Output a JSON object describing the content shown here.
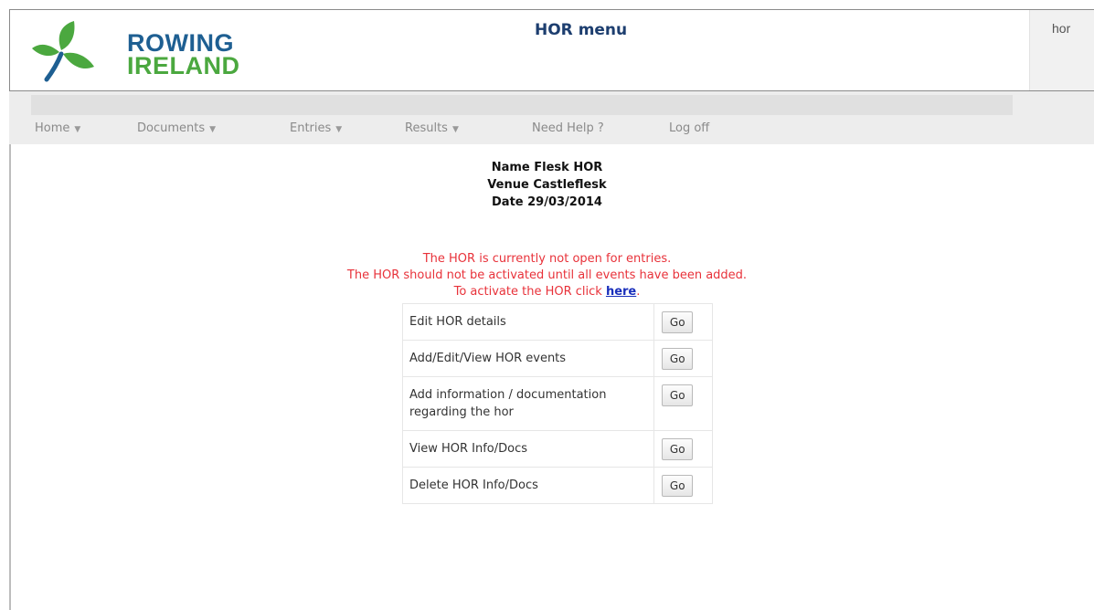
{
  "header": {
    "brand_line1": "ROWING",
    "brand_line2": "IRELAND",
    "app_title": "HOR menu",
    "username": "hor"
  },
  "nav": [
    {
      "label": "Home",
      "has_dropdown": true
    },
    {
      "label": "Documents",
      "has_dropdown": true
    },
    {
      "label": "Entries",
      "has_dropdown": true
    },
    {
      "label": "Results",
      "has_dropdown": true
    },
    {
      "label": "Need Help ?",
      "has_dropdown": false
    },
    {
      "label": "Log off",
      "has_dropdown": false
    }
  ],
  "event": {
    "name": "Name Flesk HOR",
    "venue": "Venue Castleflesk",
    "date": "Date 29/03/2014"
  },
  "notice": {
    "line1": "The HOR is currently not open for entries.",
    "line2": "The HOR should not be activated until all events have been added.",
    "line3_prefix": "To activate the HOR click ",
    "line3_link": "here",
    "line3_suffix": "."
  },
  "menu": [
    {
      "label": "Edit HOR details",
      "button": "Go"
    },
    {
      "label": "Add/Edit/View HOR events",
      "button": "Go"
    },
    {
      "label": "Add information / documentation regarding the hor",
      "button": "Go"
    },
    {
      "label": "View HOR Info/Docs",
      "button": "Go"
    },
    {
      "label": "Delete HOR Info/Docs",
      "button": "Go"
    }
  ],
  "colors": {
    "brand_blue": "#1e5f92",
    "brand_green": "#4ba83f",
    "notice_red": "#e8323a",
    "link_blue": "#1a2fbb"
  },
  "icons": {
    "logo": "rowing-ireland-shamrock-logo",
    "dropdown": "caret-down-icon"
  }
}
